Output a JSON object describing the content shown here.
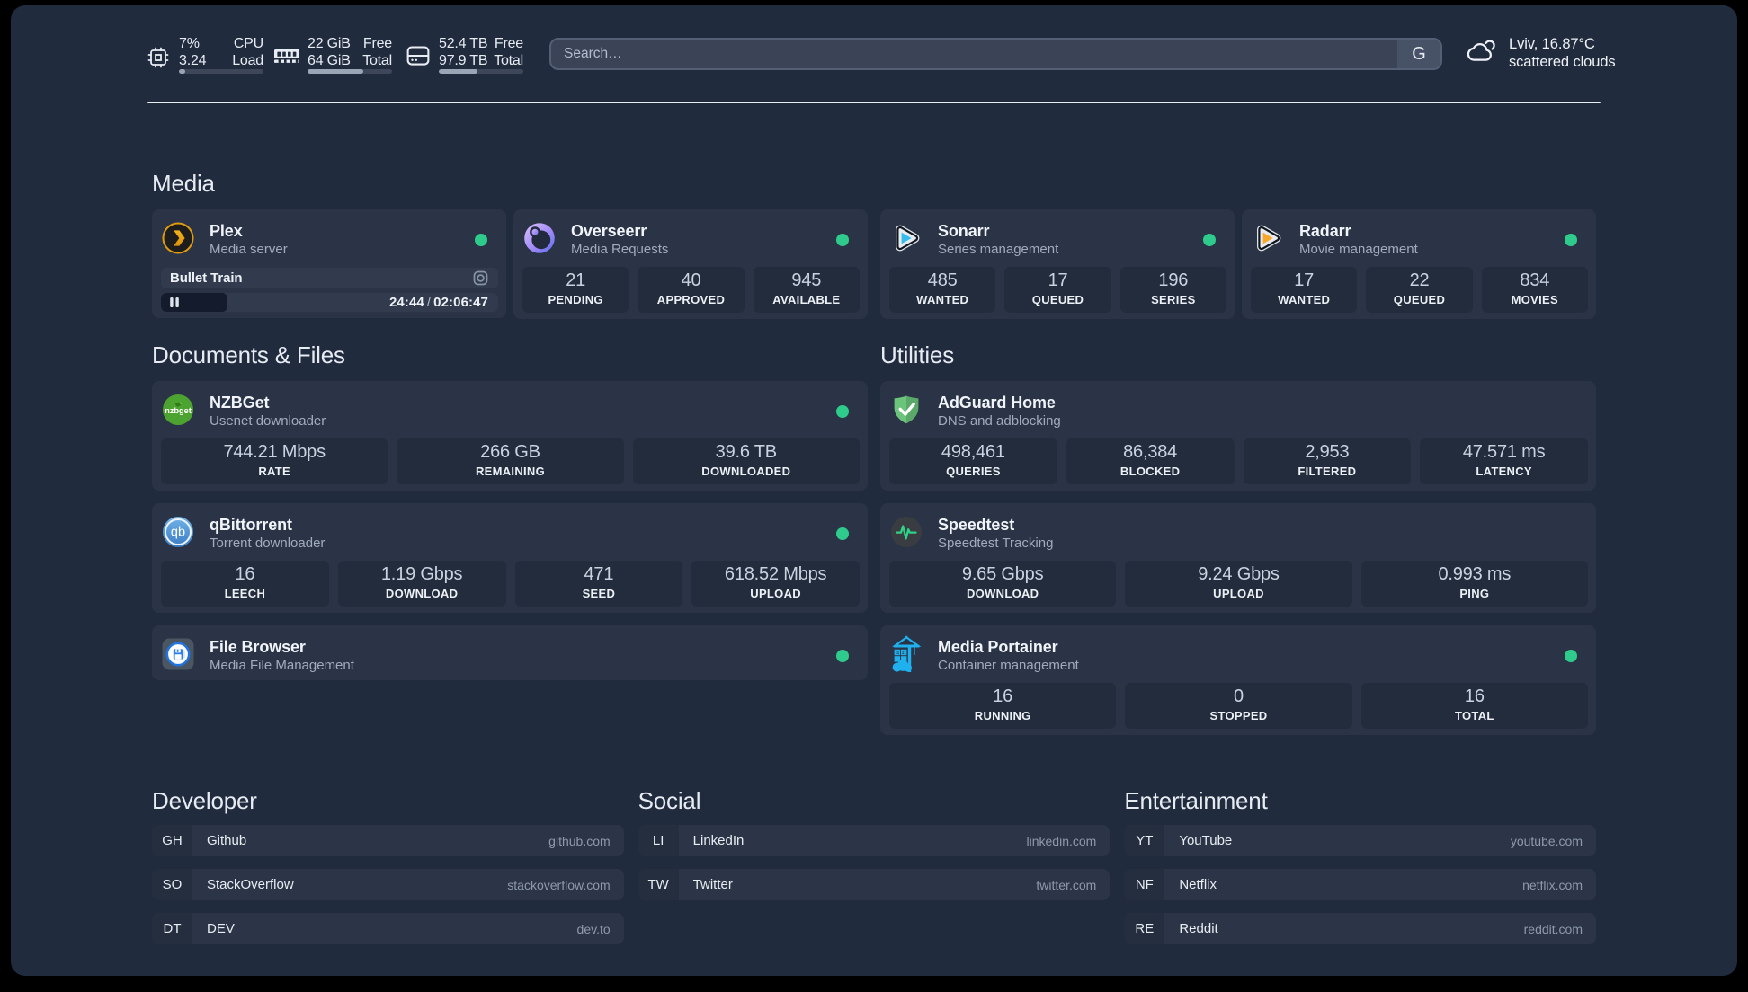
{
  "topbar": {
    "search": {
      "placeholder": "Search…",
      "button_label": "G"
    },
    "resources": [
      {
        "icon": "cpu-icon",
        "values": [
          "7%",
          "3.24"
        ],
        "labels": [
          "CPU",
          "Load"
        ],
        "percent": 7
      },
      {
        "icon": "memory-icon",
        "values": [
          "22 GiB",
          "64 GiB"
        ],
        "labels": [
          "Free",
          "Total"
        ],
        "percent": 66
      },
      {
        "icon": "disk-icon",
        "values": [
          "52.4 TB",
          "97.9 TB"
        ],
        "labels": [
          "Free",
          "Total"
        ],
        "percent": 46
      }
    ],
    "weather": {
      "icon": "cloud-moon-icon",
      "location_temp": "Lviv, 16.87°C",
      "condition": "scattered clouds"
    }
  },
  "sections": [
    {
      "title": "Media",
      "services": [
        {
          "name": "Plex",
          "description": "Media server",
          "icon": "plex-icon",
          "online": true,
          "player": {
            "title": "Bullet Train",
            "elapsed": "24:44",
            "separator": "/",
            "duration": "02:06:47",
            "progress_percent": 19.7
          }
        },
        {
          "name": "Overseerr",
          "description": "Media Requests",
          "icon": "overseerr-icon",
          "online": true,
          "stats": [
            {
              "value": "21",
              "label": "PENDING"
            },
            {
              "value": "40",
              "label": "APPROVED"
            },
            {
              "value": "945",
              "label": "AVAILABLE"
            }
          ]
        },
        {
          "name": "Sonarr",
          "description": "Series management",
          "icon": "sonarr-icon",
          "online": true,
          "stats": [
            {
              "value": "485",
              "label": "WANTED"
            },
            {
              "value": "17",
              "label": "QUEUED"
            },
            {
              "value": "196",
              "label": "SERIES"
            }
          ]
        },
        {
          "name": "Radarr",
          "description": "Movie management",
          "icon": "radarr-icon",
          "online": true,
          "stats": [
            {
              "value": "17",
              "label": "WANTED"
            },
            {
              "value": "22",
              "label": "QUEUED"
            },
            {
              "value": "834",
              "label": "MOVIES"
            }
          ]
        }
      ]
    },
    {
      "title": "Documents & Files",
      "services": [
        {
          "name": "NZBGet",
          "description": "Usenet downloader",
          "icon": "nzbget-icon",
          "online": true,
          "stats": [
            {
              "value": "744.21 Mbps",
              "label": "RATE"
            },
            {
              "value": "266 GB",
              "label": "REMAINING"
            },
            {
              "value": "39.6 TB",
              "label": "DOWNLOADED"
            }
          ]
        },
        {
          "name": "qBittorrent",
          "description": "Torrent downloader",
          "icon": "qbittorrent-icon",
          "online": true,
          "stats": [
            {
              "value": "16",
              "label": "LEECH"
            },
            {
              "value": "1.19 Gbps",
              "label": "DOWNLOAD"
            },
            {
              "value": "471",
              "label": "SEED"
            },
            {
              "value": "618.52 Mbps",
              "label": "UPLOAD"
            }
          ]
        },
        {
          "name": "File Browser",
          "description": "Media File Management",
          "icon": "filebrowser-icon",
          "online": true
        }
      ]
    },
    {
      "title": "Utilities",
      "services": [
        {
          "name": "AdGuard Home",
          "description": "DNS and adblocking",
          "icon": "adguard-icon",
          "online": false,
          "stats": [
            {
              "value": "498,461",
              "label": "QUERIES"
            },
            {
              "value": "86,384",
              "label": "BLOCKED"
            },
            {
              "value": "2,953",
              "label": "FILTERED"
            },
            {
              "value": "47.571 ms",
              "label": "LATENCY"
            }
          ]
        },
        {
          "name": "Speedtest",
          "description": "Speedtest Tracking",
          "icon": "speedtest-icon",
          "online": false,
          "stats": [
            {
              "value": "9.65 Gbps",
              "label": "DOWNLOAD"
            },
            {
              "value": "9.24 Gbps",
              "label": "UPLOAD"
            },
            {
              "value": "0.993 ms",
              "label": "PING"
            }
          ]
        },
        {
          "name": "Media Portainer",
          "description": "Container management",
          "icon": "portainer-icon",
          "online": true,
          "stats": [
            {
              "value": "16",
              "label": "RUNNING"
            },
            {
              "value": "0",
              "label": "STOPPED"
            },
            {
              "value": "16",
              "label": "TOTAL"
            }
          ]
        }
      ]
    }
  ],
  "bookmarks": [
    {
      "title": "Developer",
      "items": [
        {
          "abbr": "GH",
          "name": "Github",
          "url": "github.com"
        },
        {
          "abbr": "SO",
          "name": "StackOverflow",
          "url": "stackoverflow.com"
        },
        {
          "abbr": "DT",
          "name": "DEV",
          "url": "dev.to"
        }
      ]
    },
    {
      "title": "Social",
      "items": [
        {
          "abbr": "LI",
          "name": "LinkedIn",
          "url": "linkedin.com"
        },
        {
          "abbr": "TW",
          "name": "Twitter",
          "url": "twitter.com"
        }
      ]
    },
    {
      "title": "Entertainment",
      "items": [
        {
          "abbr": "YT",
          "name": "YouTube",
          "url": "youtube.com"
        },
        {
          "abbr": "NF",
          "name": "Netflix",
          "url": "netflix.com"
        },
        {
          "abbr": "RE",
          "name": "Reddit",
          "url": "reddit.com"
        }
      ]
    }
  ],
  "colors": {
    "status_online": "#2fcb8c",
    "accent_plex": "#e5a00d",
    "page_bg": "#212b3e"
  }
}
